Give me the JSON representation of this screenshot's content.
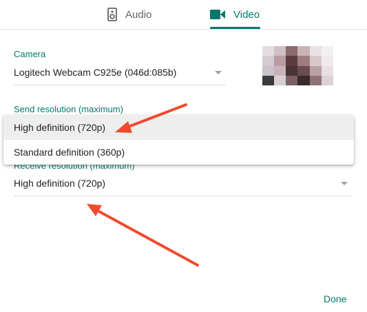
{
  "tabs": {
    "audio": {
      "label": "Audio",
      "icon": "speaker-icon"
    },
    "video": {
      "label": "Video",
      "icon": "videocam-icon"
    }
  },
  "camera": {
    "label": "Camera",
    "value": "Logitech Webcam C925e (046d:085b)"
  },
  "send_resolution": {
    "label": "Send resolution (maximum)",
    "options": [
      "High definition (720p)",
      "Standard definition (360p)"
    ],
    "selected": "High definition (720p)"
  },
  "receive_resolution": {
    "label": "Receive resolution (maximum)",
    "value": "High definition (720p)"
  },
  "done_label": "Done",
  "colors": {
    "accent": "#00796b",
    "annotation_arrow": "#f24a2c"
  }
}
